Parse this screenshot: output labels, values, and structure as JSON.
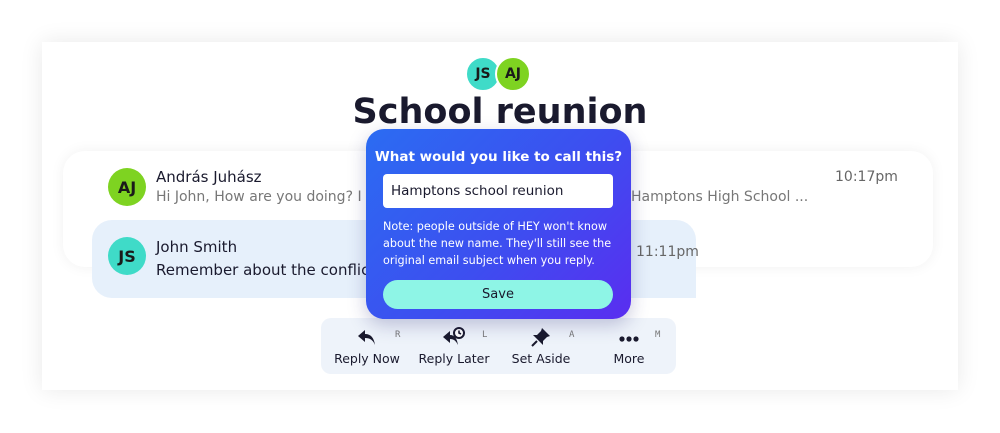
{
  "participants": [
    {
      "initials": "JS",
      "color": "#3fdbc8"
    },
    {
      "initials": "AJ",
      "color": "#7ed321"
    }
  ],
  "thread_title": "School reunion",
  "messages": [
    {
      "initials": "AJ",
      "sender": "András Juhász",
      "snippet_start": "Hi John, How are you doing? I wa",
      "snippet_end": "Hamptons High School ...",
      "time": "10:17pm"
    },
    {
      "initials": "JS",
      "sender": "John Smith",
      "snippet": "Remember about the conflicti",
      "time": "11:11pm"
    }
  ],
  "rename_popup": {
    "heading": "What would you like to call this?",
    "input_value": "Hamptons school reunion",
    "note": "Note: people outside of HEY won't know about the new name. They'll still see the original email subject when you reply.",
    "save_label": "Save"
  },
  "toolbar": {
    "actions": [
      {
        "label": "Reply Now",
        "shortcut": "R",
        "icon": "reply-icon"
      },
      {
        "label": "Reply Later",
        "shortcut": "L",
        "icon": "reply-later-icon"
      },
      {
        "label": "Set Aside",
        "shortcut": "A",
        "icon": "pin-icon"
      },
      {
        "label": "More",
        "shortcut": "M",
        "icon": "more-icon"
      }
    ]
  }
}
